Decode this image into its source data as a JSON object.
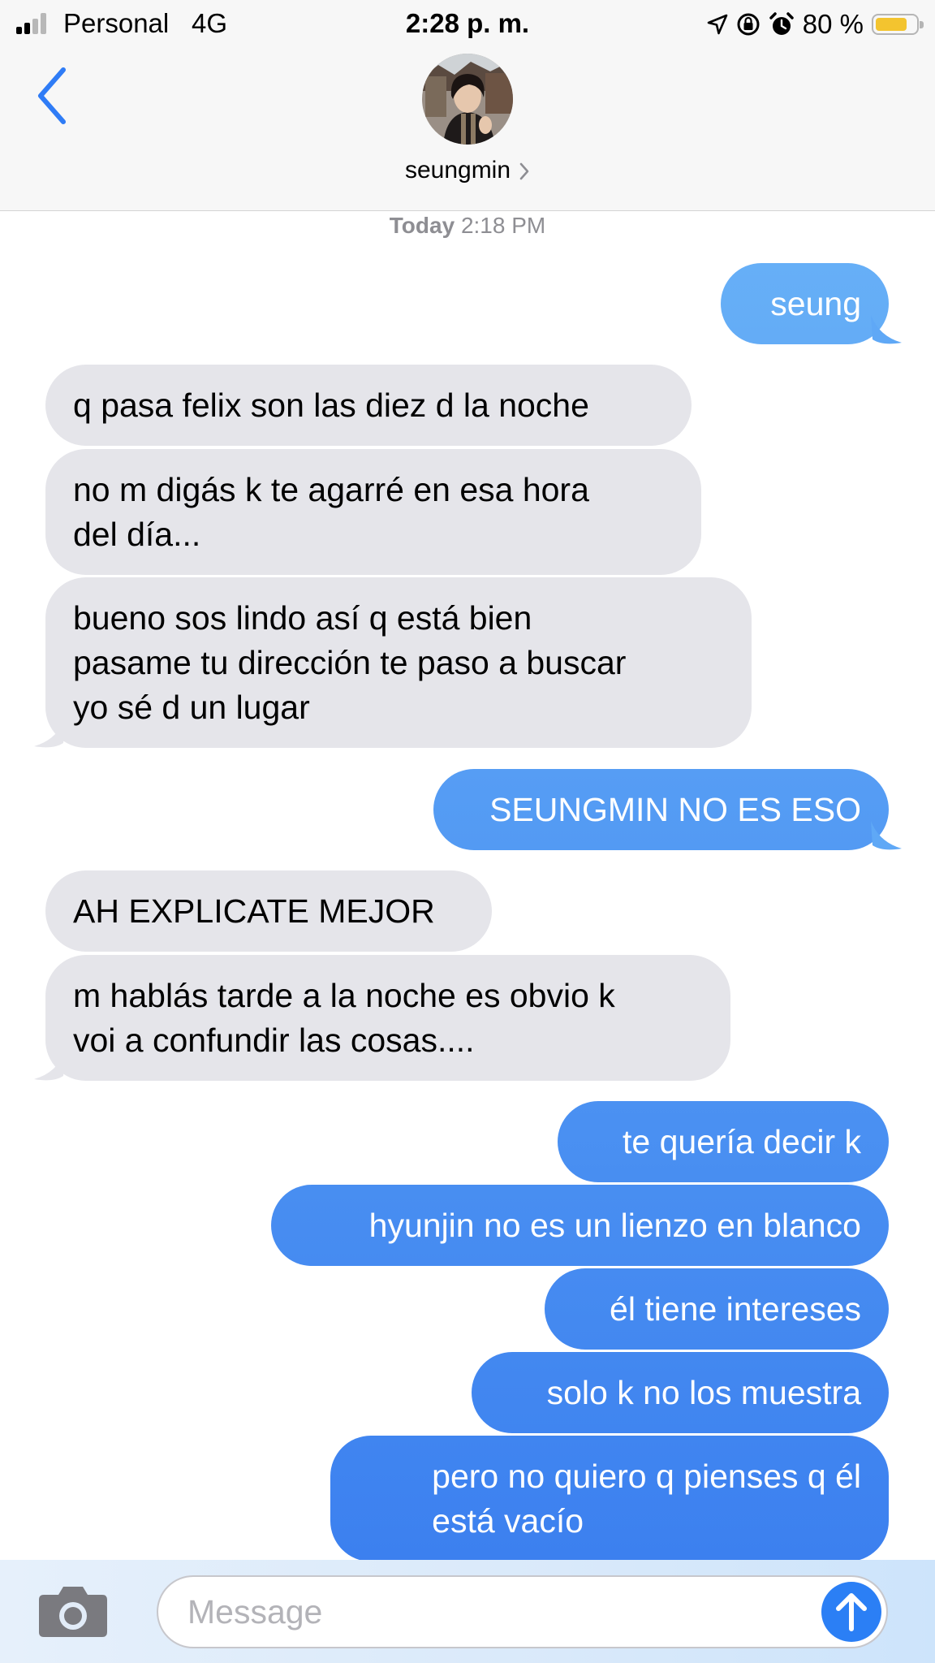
{
  "status_bar": {
    "carrier": "Personal",
    "network": "4G",
    "time": "2:28 p. m.",
    "battery_text": "80 %",
    "battery_level": 0.8,
    "icons": [
      "signal-bars-icon",
      "location-arrow-icon",
      "rotation-lock-icon",
      "alarm-icon",
      "battery-icon"
    ]
  },
  "header": {
    "back_icon": "chevron-left-icon",
    "contact_name": "seungmin",
    "avatar_icon": "contact-photo"
  },
  "thread": {
    "timestamp_day": "Today",
    "timestamp_time": "2:18 PM",
    "messages": [
      {
        "from": "me",
        "lines": [
          "seung"
        ]
      },
      {
        "from": "them",
        "lines": [
          "q pasa felix son las diez d la noche"
        ]
      },
      {
        "from": "them",
        "lines": [
          "no m digás k te agarré en esa hora",
          "del día..."
        ]
      },
      {
        "from": "them",
        "lines": [
          "bueno sos lindo así q está bien",
          "pasame tu dirección te paso a buscar",
          "yo sé d un lugar"
        ]
      },
      {
        "from": "me",
        "lines": [
          "SEUNGMIN NO ES ESO"
        ]
      },
      {
        "from": "them",
        "lines": [
          "AH EXPLICATE MEJOR"
        ]
      },
      {
        "from": "them",
        "lines": [
          "m hablás tarde a la noche es obvio k",
          "voi a confundir las cosas...."
        ]
      },
      {
        "from": "me",
        "lines": [
          "te quería decir k"
        ]
      },
      {
        "from": "me",
        "lines": [
          "hyunjin no es un lienzo en blanco"
        ]
      },
      {
        "from": "me",
        "lines": [
          "él tiene intereses"
        ]
      },
      {
        "from": "me",
        "lines": [
          "solo k no los muestra"
        ]
      },
      {
        "from": "me",
        "lines": [
          "pero no quiero q pienses q él",
          "está vacío"
        ]
      }
    ]
  },
  "composer": {
    "placeholder": "Message",
    "camera_icon": "camera-icon",
    "send_icon": "send-arrow-up-icon"
  },
  "colors": {
    "incoming_bubble": "#e5e5ea",
    "outgoing_top": "#67b0f7",
    "outgoing_bottom": "#3c80ef",
    "ios_blue": "#2f7cf6"
  }
}
